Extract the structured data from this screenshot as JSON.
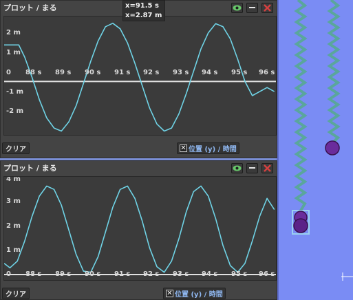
{
  "colors": {
    "plot_line": "#6fd3e6",
    "axis_line": "#e0e0e0",
    "panel_bg": "#444444",
    "plot_bg": "#3b3b3b",
    "sim_bg": "#7a8cf4",
    "spring": "#6fb0a8",
    "mass": "#6a2c9c",
    "close_red": "#d44040",
    "eye_green": "#67c76a"
  },
  "panel1": {
    "title": "プロット / まる",
    "y_ticks": [
      "2 m",
      "1 m",
      "0",
      "-1 m",
      "-2 m"
    ],
    "x_ticks": [
      "88 s",
      "89 s",
      "90 s",
      "91 s",
      "92 s",
      "93 s",
      "94 s",
      "95 s",
      "96 s"
    ],
    "clear_label": "クリア",
    "legend_check": "✕",
    "legend_label": "位置 (y) / 時間",
    "tooltip_x": "x=91.5 s",
    "tooltip_y": "x=2.87 m",
    "icons": {
      "eye": "eye-icon",
      "minimize": "minimize-icon",
      "close": "close-icon"
    }
  },
  "panel2": {
    "title": "プロット / まる",
    "y_ticks": [
      "4 m",
      "3 m",
      "2 m",
      "1 m",
      "0"
    ],
    "x_ticks": [
      "88 s",
      "89 s",
      "90 s",
      "91 s",
      "92 s",
      "93 s",
      "94 s",
      "95 s",
      "96 s"
    ],
    "clear_label": "クリア",
    "legend_check": "✕",
    "legend_label": "位置 (y) / 時間",
    "icons": {
      "eye": "eye-icon",
      "minimize": "minimize-icon",
      "close": "close-icon"
    }
  },
  "chart_data": [
    {
      "type": "line",
      "title": "",
      "xlabel": "",
      "ylabel": "",
      "xlim": [
        87.3,
        96.6
      ],
      "ylim": [
        -2.5,
        3.0
      ],
      "series": [
        {
          "x": [
            87.3,
            87.55,
            87.8,
            88.0,
            88.25,
            88.5,
            88.75,
            89.0,
            89.25,
            89.5,
            89.75,
            90.0,
            90.25,
            90.5,
            90.75,
            91.0,
            91.25,
            91.5,
            91.75,
            92.0,
            92.25,
            92.5,
            92.75,
            93.0,
            93.25,
            93.5,
            93.75,
            94.0,
            94.25,
            94.5,
            94.75,
            95.0,
            95.25,
            95.5,
            95.75,
            96.0,
            96.25,
            96.5
          ],
          "y": [
            1.8,
            1.8,
            1.8,
            1.2,
            0.2,
            -0.9,
            -1.8,
            -2.3,
            -2.45,
            -2.0,
            -1.2,
            -0.1,
            1.0,
            2.0,
            2.7,
            2.87,
            2.6,
            1.9,
            0.9,
            -0.2,
            -1.3,
            -2.1,
            -2.45,
            -2.3,
            -1.6,
            -0.6,
            0.5,
            1.6,
            2.4,
            2.85,
            2.7,
            2.1,
            1.1,
            0.0,
            -0.7,
            -0.5,
            -0.3,
            -0.5
          ]
        }
      ]
    },
    {
      "type": "line",
      "title": "",
      "xlabel": "",
      "ylabel": "",
      "xlim": [
        87.3,
        96.6
      ],
      "ylim": [
        0,
        4.3
      ],
      "series": [
        {
          "x": [
            87.3,
            87.5,
            87.75,
            88.0,
            88.25,
            88.5,
            88.75,
            89.0,
            89.25,
            89.5,
            89.75,
            90.0,
            90.25,
            90.5,
            90.75,
            91.0,
            91.25,
            91.5,
            91.75,
            92.0,
            92.25,
            92.5,
            92.75,
            93.0,
            93.25,
            93.5,
            93.75,
            94.0,
            94.25,
            94.5,
            94.75,
            95.0,
            95.25,
            95.5,
            95.75,
            96.0,
            96.25,
            96.5
          ],
          "y": [
            0.5,
            0.3,
            0.6,
            1.5,
            2.6,
            3.5,
            3.95,
            3.8,
            3.1,
            2.0,
            0.9,
            0.15,
            0.1,
            0.8,
            1.9,
            3.0,
            3.8,
            3.95,
            3.4,
            2.4,
            1.2,
            0.35,
            0.1,
            0.6,
            1.6,
            2.8,
            3.7,
            3.95,
            3.5,
            2.5,
            1.3,
            0.4,
            0.1,
            0.5,
            1.5,
            2.6,
            3.4,
            2.9
          ]
        }
      ]
    }
  ]
}
